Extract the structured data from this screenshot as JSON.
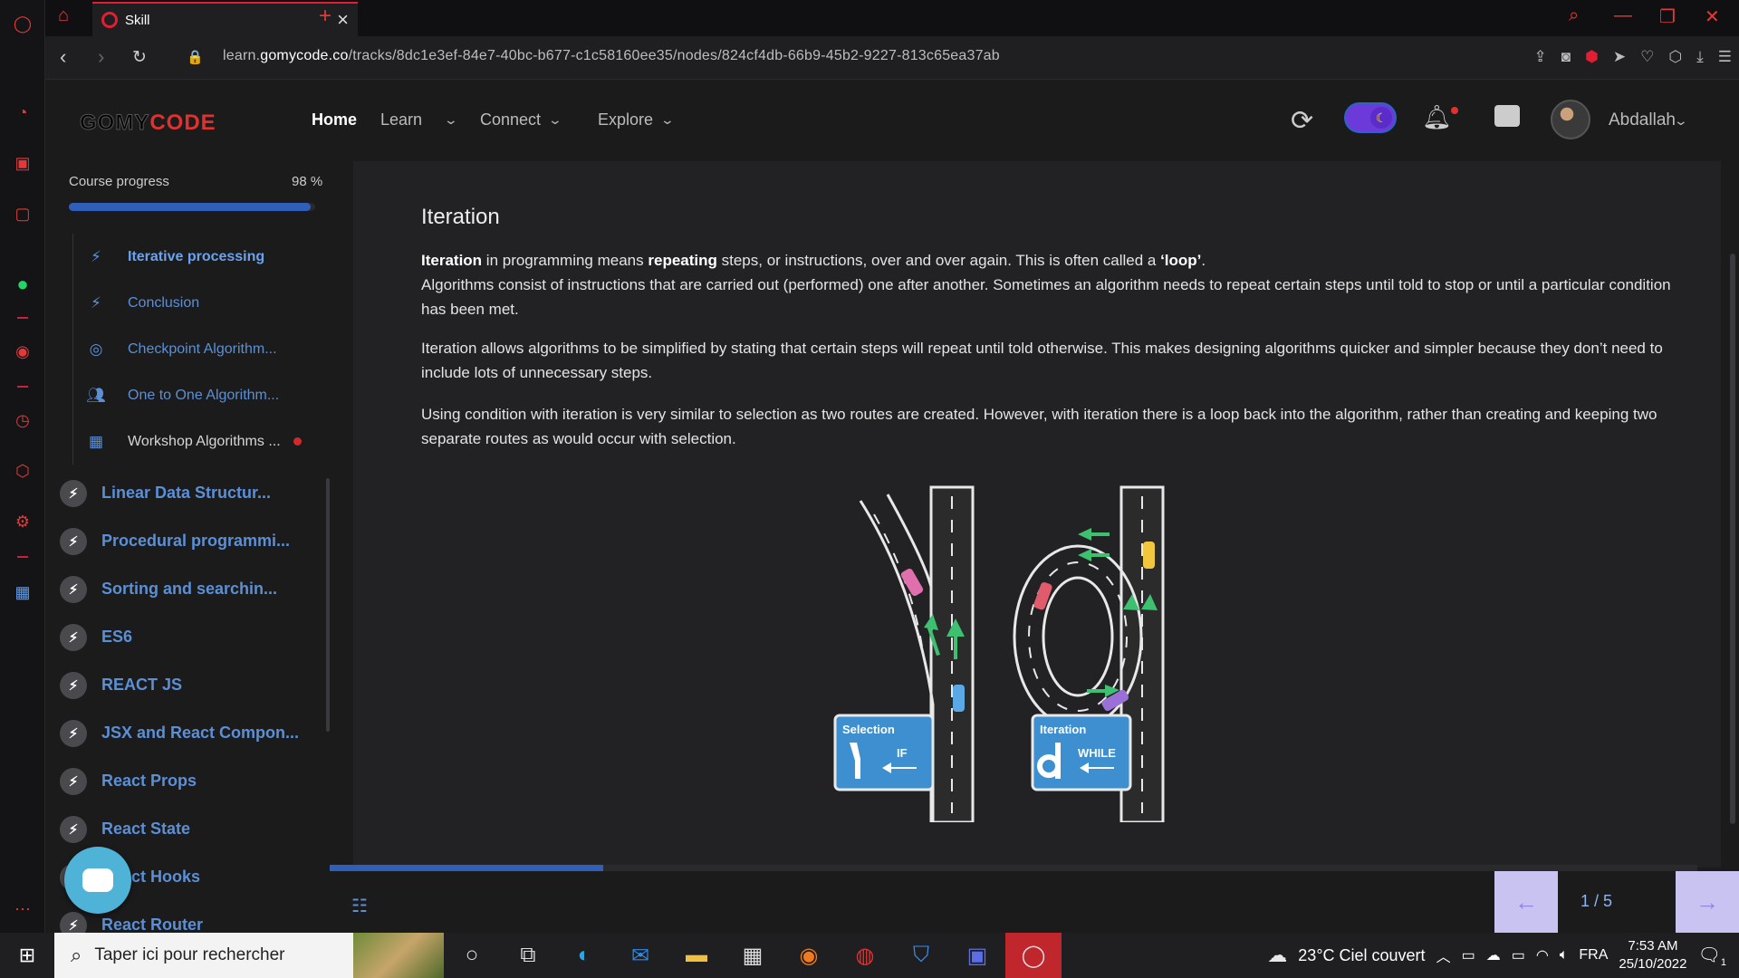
{
  "browser": {
    "tab_title": "Skill",
    "url_prefix": "learn.",
    "url_domain": "gomycode.co",
    "url_path": "/tracks/8dc1e3ef-84e7-40bc-b677-c1c58160ee35/nodes/824cf4db-66b9-45b2-9227-813c65ea37ab"
  },
  "header": {
    "logo_main": "GOMY",
    "logo_accent": "CODE",
    "nav": [
      "Home",
      "Learn",
      "Connect",
      "Explore"
    ],
    "user_name": "Abdallah"
  },
  "sidebar": {
    "progress_label": "Course progress",
    "progress_value": "98 %",
    "progress_fraction": 0.98,
    "sub_items": [
      {
        "label": "Iterative processing",
        "icon": "bolt-icon"
      },
      {
        "label": "Conclusion",
        "icon": "bolt-icon"
      },
      {
        "label": "Checkpoint Algorithm...",
        "icon": "target-icon"
      },
      {
        "label": "One to One Algorithm...",
        "icon": "people-icon"
      },
      {
        "label": "Workshop Algorithms ...",
        "icon": "workshop-icon"
      }
    ],
    "modules": [
      "Linear Data Structur...",
      "Procedural programmi...",
      "Sorting and searchin...",
      "ES6",
      "REACT JS",
      "JSX and React Compon...",
      "React Props",
      "React State",
      "React Hooks",
      "React Router"
    ]
  },
  "lesson": {
    "title": "Iteration",
    "p1_b1": "Iteration",
    "p1_t1": " in programming means ",
    "p1_b2": "repeating",
    "p1_t2": " steps, or instructions, over and over again. This is often called a ",
    "p1_b3": "‘loop’",
    "p1_t3": ".",
    "p1_line2": "Algorithms consist of instructions that are carried out (performed) one after another. Sometimes an algorithm needs to repeat certain steps until told to stop or until a particular condition has been met.",
    "p2": "Iteration allows algorithms to be simplified by stating that certain steps will repeat until told otherwise. This makes designing algorithms quicker and simpler because they don’t need to include lots of unnecessary steps.",
    "p3": "Using condition with iteration is very similar to selection as two routes are created. However, with iteration there is a loop back into the algorithm, rather than creating and keeping two separate routes as would occur with selection.",
    "diagram": {
      "sign1_title": "Selection",
      "sign1_word": "IF",
      "sign2_title": "Iteration",
      "sign2_word": "WHILE"
    }
  },
  "pager": {
    "indicator": "1 / 5",
    "slide_fraction": 0.2
  },
  "taskbar": {
    "search_placeholder": "Taper ici pour rechercher",
    "weather": "23°C  Ciel couvert",
    "lang": "FRA",
    "time": "7:53 AM",
    "date": "25/10/2022",
    "notif_count": "1"
  },
  "colors": {
    "accent_blue": "#2f5fb8",
    "brand_red": "#e03131",
    "link_blue": "#5b8fd6"
  }
}
